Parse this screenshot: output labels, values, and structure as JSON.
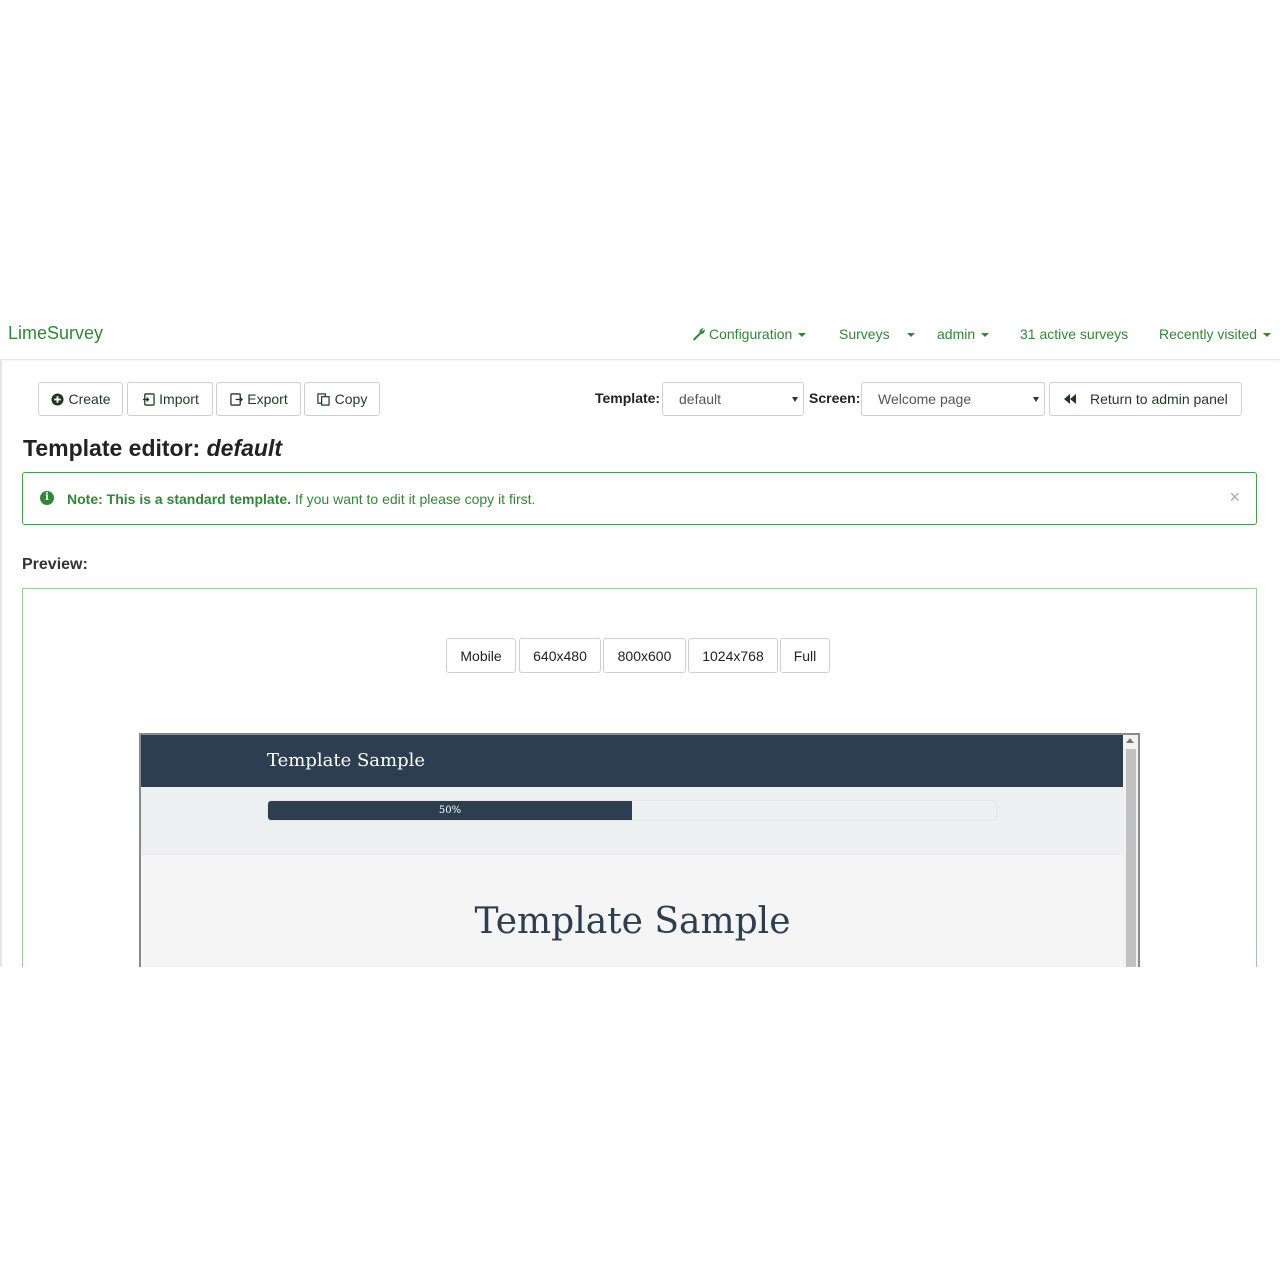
{
  "navbar": {
    "brand": "LimeSurvey",
    "configuration": "Configuration",
    "surveys": "Surveys",
    "admin": "admin",
    "active_surveys": "31 active surveys",
    "recently_visited": "Recently visited"
  },
  "toolbar": {
    "create": "Create",
    "import": "Import",
    "export": "Export",
    "copy": "Copy",
    "template_label": "Template:",
    "template_value": "default",
    "screen_label": "Screen:",
    "screen_value": "Welcome page",
    "return_label": "Return to admin panel"
  },
  "page": {
    "title_prefix": "Template editor: ",
    "title_name": "default"
  },
  "alert": {
    "strong": "Note: This is a standard template.",
    "text": " If you want to edit it please copy it first.",
    "close": "×"
  },
  "preview": {
    "label": "Preview:",
    "sizes": [
      "Mobile",
      "640x480",
      "800x600",
      "1024x768",
      "Full"
    ],
    "sample_header_title": "Template Sample",
    "progress_percent": 50,
    "progress_label": "50%",
    "sample_body_title": "Template Sample"
  },
  "colors": {
    "accent": "#328637",
    "alert_border": "#46a04b",
    "sample_dark": "#2c3e50"
  }
}
